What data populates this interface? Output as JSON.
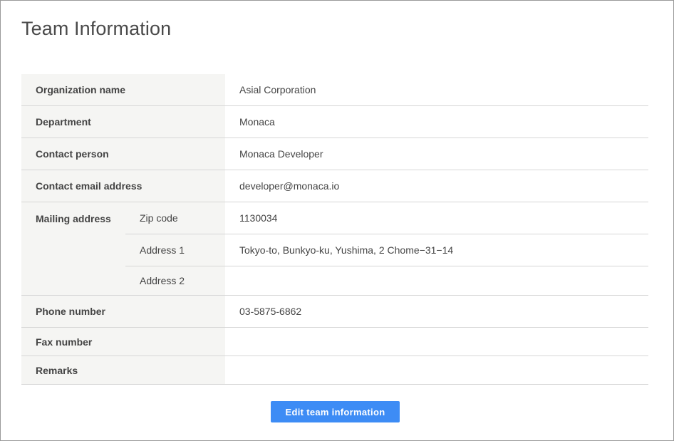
{
  "page": {
    "title": "Team Information"
  },
  "team": {
    "organization_name": {
      "label": "Organization name",
      "value": "Asial Corporation"
    },
    "department": {
      "label": "Department",
      "value": "Monaca"
    },
    "contact_person": {
      "label": "Contact person",
      "value": "Monaca Developer"
    },
    "contact_email": {
      "label": "Contact email address",
      "value": "developer@monaca.io"
    },
    "mailing_address": {
      "label": "Mailing address",
      "zip": {
        "label": "Zip code",
        "value": "1130034"
      },
      "address1": {
        "label": "Address 1",
        "value": "Tokyo-to, Bunkyo-ku, Yushima, 2 Chome−31−14"
      },
      "address2": {
        "label": "Address 2",
        "value": ""
      }
    },
    "phone": {
      "label": "Phone number",
      "value": "03-5875-6862"
    },
    "fax": {
      "label": "Fax number",
      "value": ""
    },
    "remarks": {
      "label": "Remarks",
      "value": ""
    }
  },
  "actions": {
    "edit_label": "Edit team information"
  },
  "colors": {
    "button": "#3d8cf5",
    "label_bg": "#f5f5f3",
    "border": "#d6d6d6"
  }
}
